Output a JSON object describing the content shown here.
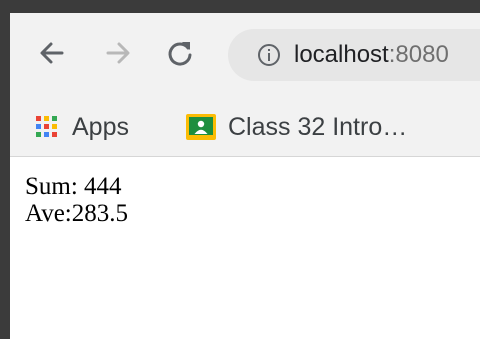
{
  "browser": {
    "url_host": "localhost",
    "url_port": ":8080",
    "bookmarks": [
      {
        "label": "Apps",
        "icon": "apps-grid-icon"
      },
      {
        "label": "Class 32 Intro…",
        "icon": "google-classroom-icon"
      }
    ],
    "icons": {
      "back": "back-arrow-icon",
      "forward": "forward-arrow-icon",
      "reload": "reload-icon",
      "info": "info-icon"
    }
  },
  "page": {
    "sum_line": "Sum: 444",
    "ave_line": "Ave:283.5"
  },
  "colors": {
    "frame": "#3b3b3b",
    "toolbar_bg": "#f2f2f2",
    "omnibox_bg": "#e6e6e6",
    "classroom_green": "#1e8e3e",
    "classroom_yellow": "#fbbc04"
  }
}
